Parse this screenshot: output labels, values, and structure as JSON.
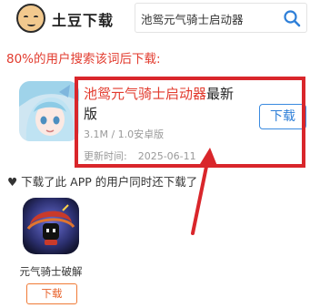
{
  "header": {
    "logo_text": "土豆下载",
    "search": {
      "value": "池鸳元气骑士启动器",
      "placeholder": ""
    },
    "search_icon": "search-icon"
  },
  "headline": "80%的用户搜索该词后下载:",
  "app": {
    "title_highlight": "池鸳元气骑士启动器",
    "title_rest": "最新版",
    "meta": "3.1M / 1.0安卓版",
    "date_label": "更新时间:",
    "date_value": "2025-06-11",
    "download_label": "下载"
  },
  "also_downloaded": {
    "title": "♥ 下载了此 APP 的用户同时还下载了",
    "items": [
      {
        "name": "元气骑士破解",
        "download_label": "下载"
      }
    ]
  },
  "colors": {
    "accent_red": "#e23b2e",
    "annotation_red": "#d9262b",
    "download_blue": "#2e7fd8",
    "download_orange": "#e8622a"
  }
}
